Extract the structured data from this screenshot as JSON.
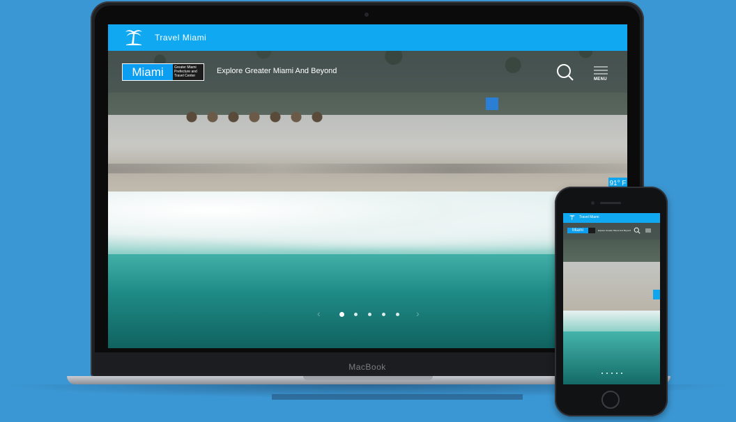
{
  "laptop": {
    "brand_label": "MacBook",
    "site": {
      "topbar_title": "Travel Miami",
      "logo_word": "Miami",
      "logo_subtitle": "Greater Miami Prefecture and Travel Center",
      "tagline": "Explore Greater Miami And Beyond",
      "menu_label": "MENU",
      "weather": "91° F",
      "carousel": {
        "slides": 5,
        "active_index": 0
      }
    }
  },
  "phone": {
    "site": {
      "topbar_title": "Travel Miami",
      "logo_word": "Miami",
      "tagline": "Explore Greater Miami And Beyond",
      "carousel": {
        "slides": 5,
        "active_index": 0
      }
    }
  },
  "colors": {
    "background": "#3b97d3",
    "accent": "#10a8f0",
    "logo_blue": "#0c9ef0"
  },
  "icons": [
    "palm-tree-icon",
    "search-icon",
    "hamburger-menu-icon",
    "chevron-left-icon",
    "chevron-right-icon"
  ]
}
